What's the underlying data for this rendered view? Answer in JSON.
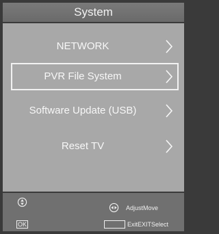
{
  "header": {
    "title": "System"
  },
  "menu": {
    "items": [
      {
        "label": "NETWORK",
        "selected": false
      },
      {
        "label": "PVR File System",
        "selected": true
      },
      {
        "label": "Software Update (USB)",
        "selected": false
      },
      {
        "label": "Reset TV",
        "selected": false
      }
    ]
  },
  "footer": {
    "updown_icon": "up-down-circle-icon",
    "ok_key": "OK",
    "leftright_icon": "left-right-circle-icon",
    "adjust_label": "AdjustMove",
    "exit_label": "ExitEXITSelect"
  },
  "colors": {
    "title_bg": "#6e6e6e",
    "panel_bg": "#a8a8a8",
    "footer_bg": "#707070",
    "text": "#f7f7f7"
  }
}
